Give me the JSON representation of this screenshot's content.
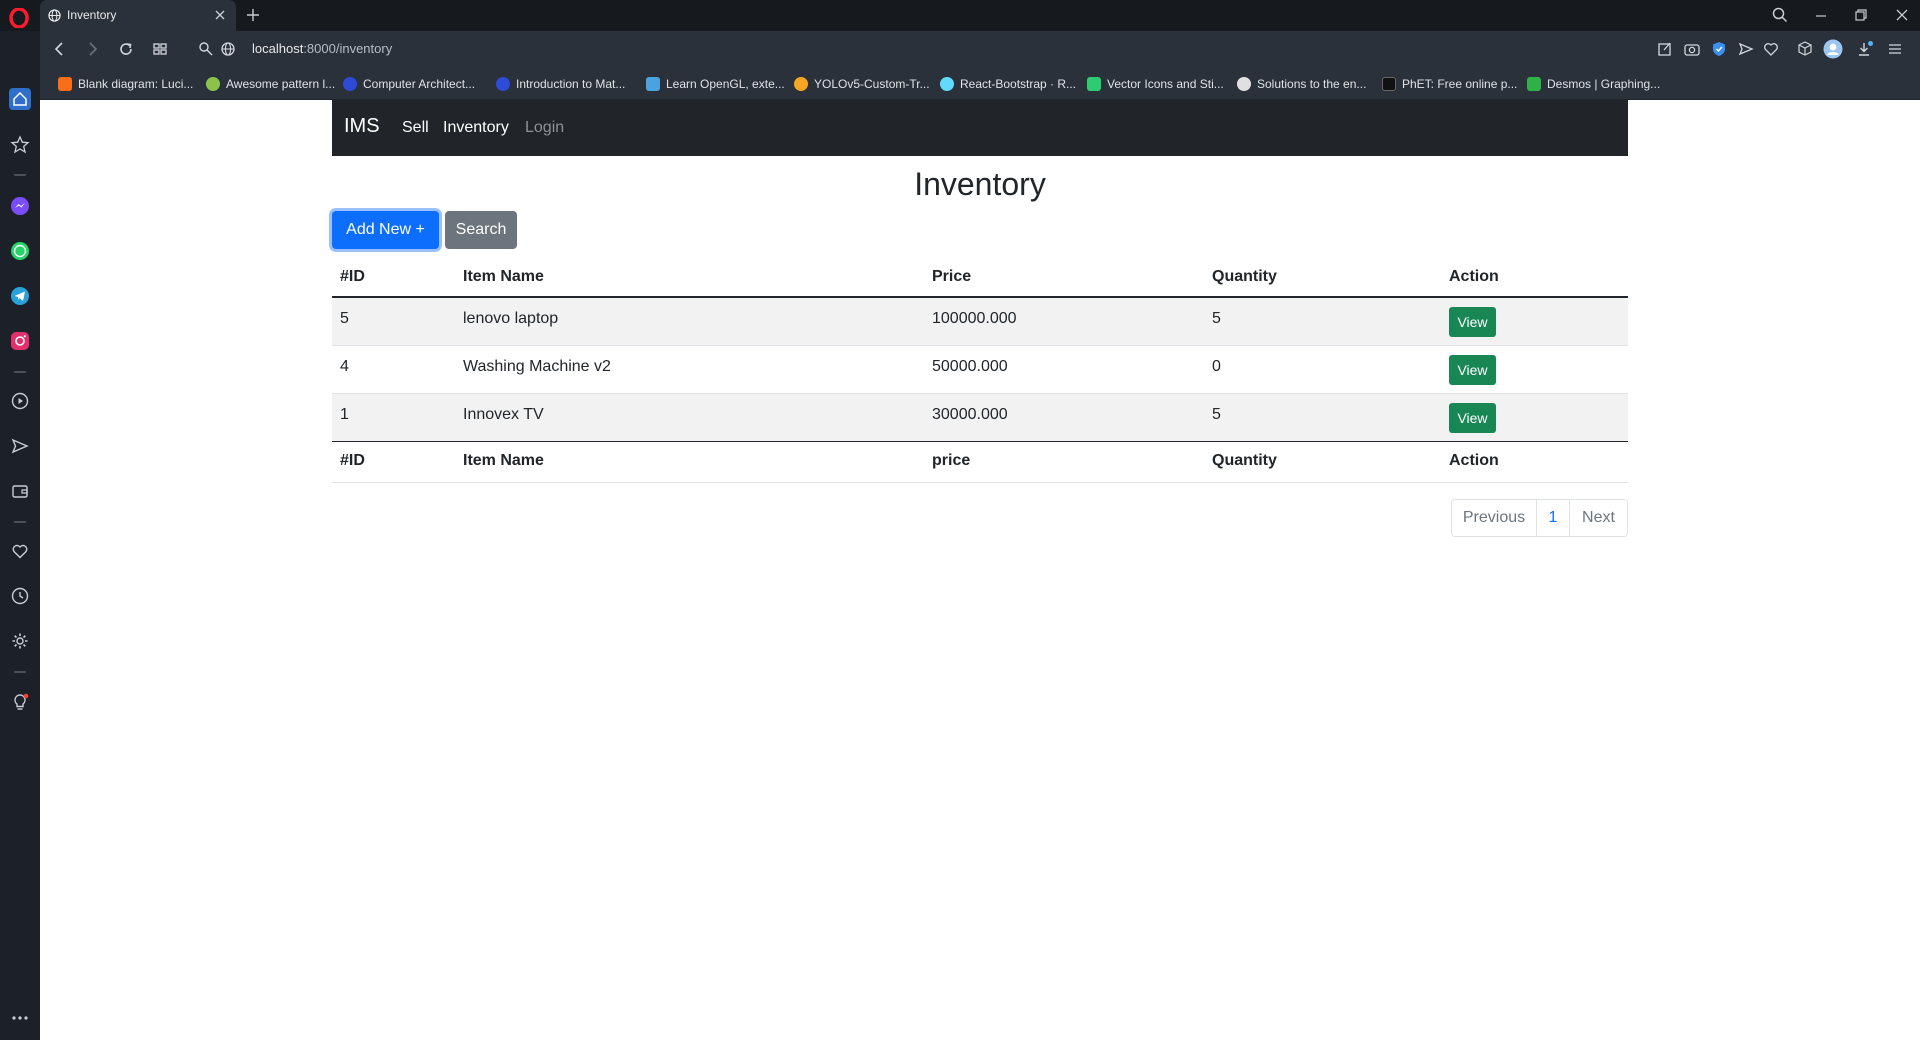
{
  "browser": {
    "tab": {
      "title": "Inventory"
    },
    "address": {
      "host": "localhost",
      "path": ":8000/inventory"
    },
    "bookmarks": [
      {
        "label": "Blank diagram: Luci...",
        "color": "#f96f19"
      },
      {
        "label": "Awesome pattern l...",
        "color": "#8bc34a"
      },
      {
        "label": "Computer Architect...",
        "color": "#2d4bd6"
      },
      {
        "label": "Introduction to Mat...",
        "color": "#2d4bd6"
      },
      {
        "label": "Learn OpenGL, exte...",
        "color": "#4aa3df"
      },
      {
        "label": "YOLOv5-Custom-Tr...",
        "color": "#f6a623"
      },
      {
        "label": "React-Bootstrap · R...",
        "color": "#61dafb"
      },
      {
        "label": "Vector Icons and Sti...",
        "color": "#2ecc71"
      },
      {
        "label": "Solutions to the en...",
        "color": "#e0e0e0"
      },
      {
        "label": "PhET: Free online p...",
        "color": "#111111"
      },
      {
        "label": "Desmos | Graphing...",
        "color": "#2fb14a"
      }
    ]
  },
  "app": {
    "brand": "IMS",
    "nav": {
      "sell": "Sell",
      "inventory": "Inventory",
      "login": "Login"
    },
    "title": "Inventory",
    "buttons": {
      "add_new": "Add New +",
      "search": "Search"
    },
    "table": {
      "header": [
        "#ID",
        "Item Name",
        "Price",
        "Quantity",
        "Action"
      ],
      "rows": [
        {
          "id": "5",
          "name": "lenovo laptop",
          "price": "100000.000",
          "quantity": "5",
          "action": "View"
        },
        {
          "id": "4",
          "name": "Washing Machine v2",
          "price": "50000.000",
          "quantity": "0",
          "action": "View"
        },
        {
          "id": "1",
          "name": "Innovex TV",
          "price": "30000.000",
          "quantity": "5",
          "action": "View"
        }
      ],
      "footer": [
        "#ID",
        "Item Name",
        "price",
        "Quantity",
        "Action"
      ]
    },
    "pagination": {
      "previous": "Previous",
      "page": "1",
      "next": "Next"
    }
  },
  "colors": {
    "primary": "#0d6efd",
    "secondary": "#6c757d",
    "success": "#198754",
    "navbar": "#212529"
  }
}
